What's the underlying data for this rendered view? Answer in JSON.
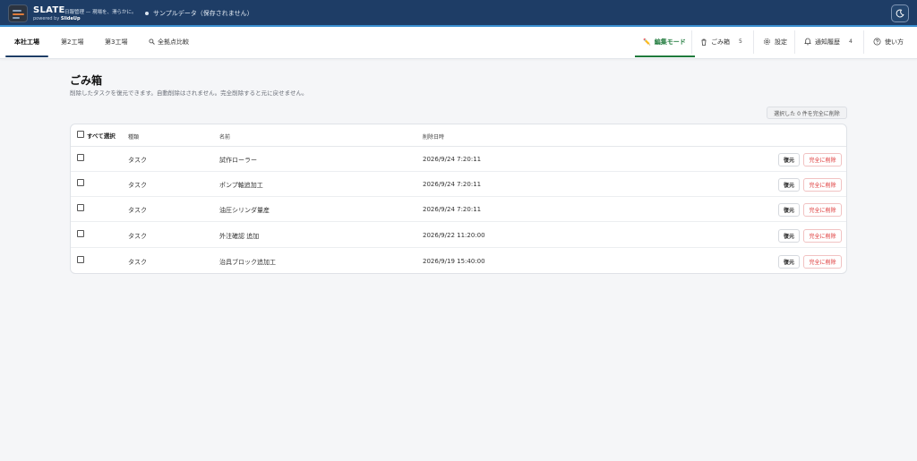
{
  "header": {
    "brand": "SLATE",
    "tagline": "日報管理 — 現場を、滑らかに。",
    "powered_prefix": "powered by ",
    "powered_name": "SlideUp",
    "sample_label": "サンプルデータ（保存されません）"
  },
  "nav": {
    "tabs": [
      {
        "label": "本社工場",
        "active": true
      },
      {
        "label": "第2工場"
      },
      {
        "label": "第3工場"
      },
      {
        "label": "全拠点比較"
      }
    ],
    "edit_mode": "編集モード",
    "trash": {
      "label": "ごみ箱",
      "count": "5"
    },
    "settings": "設定",
    "notifications": {
      "label": "通知履歴",
      "count": "4"
    },
    "help": "使い方"
  },
  "page": {
    "title": "ごみ箱",
    "description": "削除したタスクを復元できます。自動削除はされません。完全削除すると元に戻せません。",
    "bulk_delete": "選択した 0 件を完全に削除"
  },
  "table": {
    "select_all": "すべて選択",
    "headers": {
      "type": "種類",
      "name": "名前",
      "deleted_at": "削除日時"
    },
    "restore_label": "復元",
    "delete_label": "完全に削除",
    "rows": [
      {
        "type": "タスク",
        "name": "試作ローラー",
        "deleted_at": "2026/9/24 7:20:11"
      },
      {
        "type": "タスク",
        "name": "ポンプ軸追加工",
        "deleted_at": "2026/9/24 7:20:11"
      },
      {
        "type": "タスク",
        "name": "油圧シリンダ量産",
        "deleted_at": "2026/9/24 7:20:11"
      },
      {
        "type": "タスク",
        "name": "外注確認 追加",
        "deleted_at": "2026/9/22 11:20:00"
      },
      {
        "type": "タスク",
        "name": "治具ブロック追加工",
        "deleted_at": "2026/9/19 15:40:00"
      }
    ]
  }
}
